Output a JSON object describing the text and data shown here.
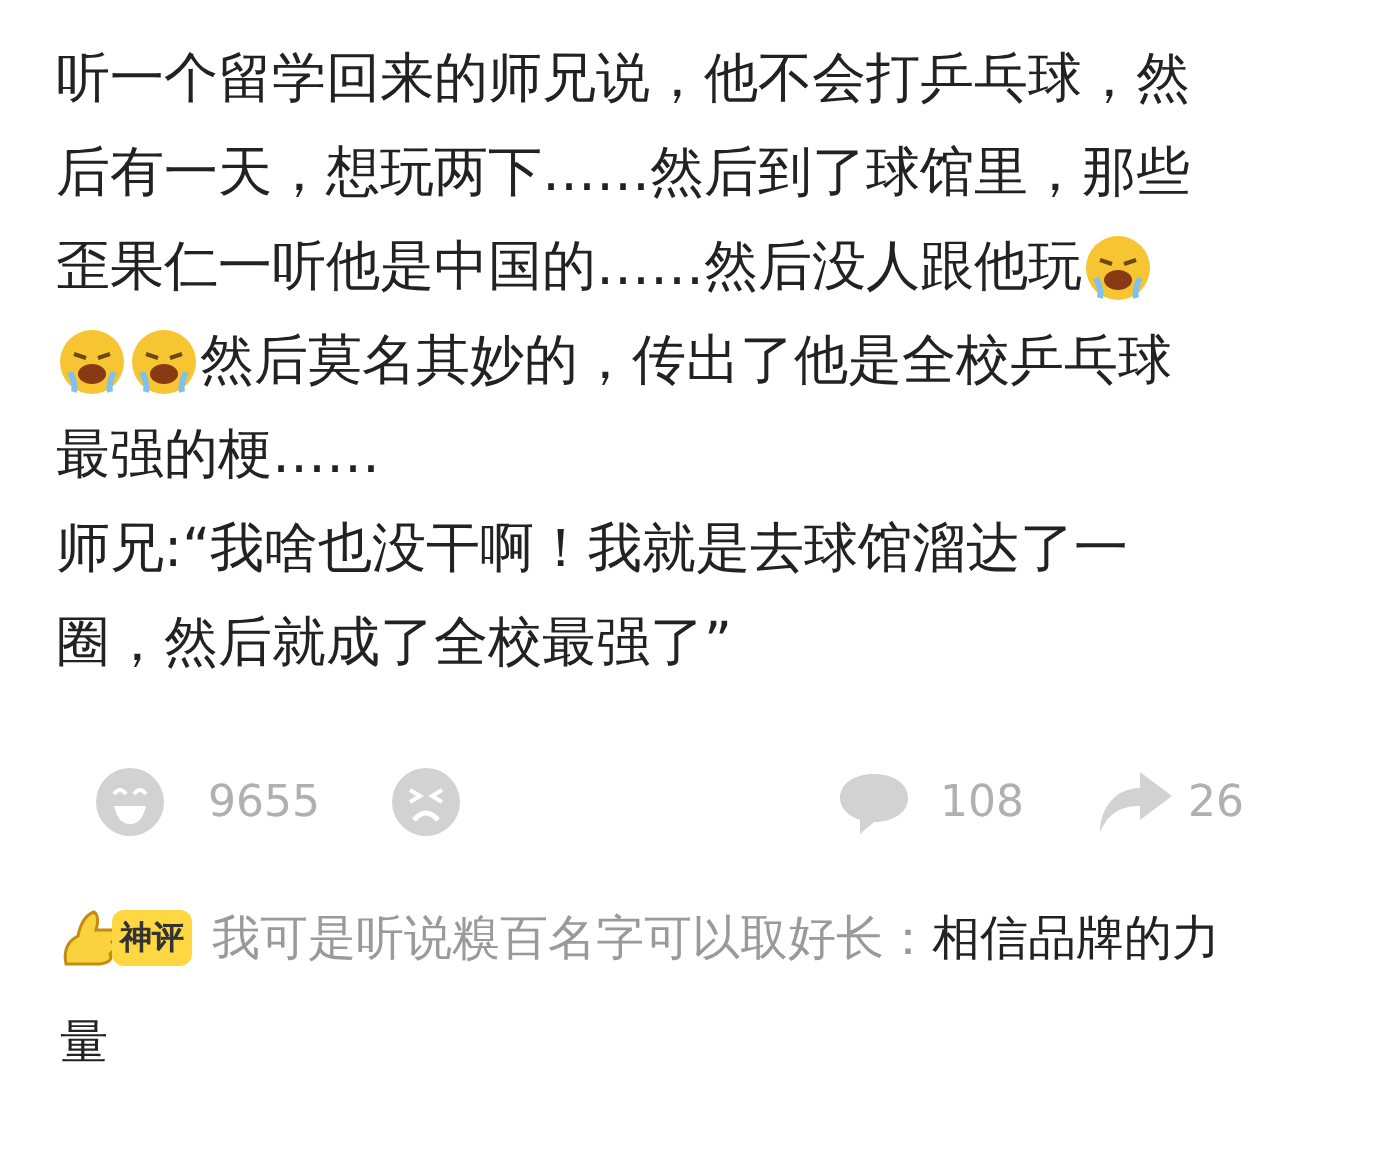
{
  "post": {
    "lines": [
      {
        "segments": [
          {
            "kind": "text",
            "text": "听一个留学回来的师兄说，他不会打乒乓球，然"
          }
        ]
      },
      {
        "segments": [
          {
            "kind": "text",
            "text": "后有一天，想玩两下……然后到了球馆里，那些"
          }
        ]
      },
      {
        "segments": [
          {
            "kind": "text",
            "text": "歪果仁一听他是中国的……然后没人跟他玩"
          },
          {
            "kind": "emoji"
          }
        ]
      },
      {
        "segments": [
          {
            "kind": "emoji"
          },
          {
            "kind": "emoji"
          },
          {
            "kind": "text",
            "text": "然后莫名其妙的，传出了他是全校乒乓球"
          }
        ]
      },
      {
        "segments": [
          {
            "kind": "text",
            "text": "最强的梗……"
          }
        ]
      },
      {
        "segments": [
          {
            "kind": "text",
            "text": "师兄:“我啥也没干啊！我就是去球馆溜达了一"
          }
        ]
      },
      {
        "segments": [
          {
            "kind": "text",
            "text": "圈，然后就成了全校最强了”"
          }
        ]
      }
    ]
  },
  "actions": [
    {
      "kind": "laugh",
      "count": "9655"
    },
    {
      "kind": "angry"
    },
    {
      "kind": "comment",
      "count": "108"
    },
    {
      "kind": "share",
      "count": "26"
    }
  ],
  "top_comment": {
    "badge": "神评",
    "author": "我可是听说糗百名字可以取好长：",
    "text_lines": [
      "相信品牌的力",
      "量"
    ]
  }
}
